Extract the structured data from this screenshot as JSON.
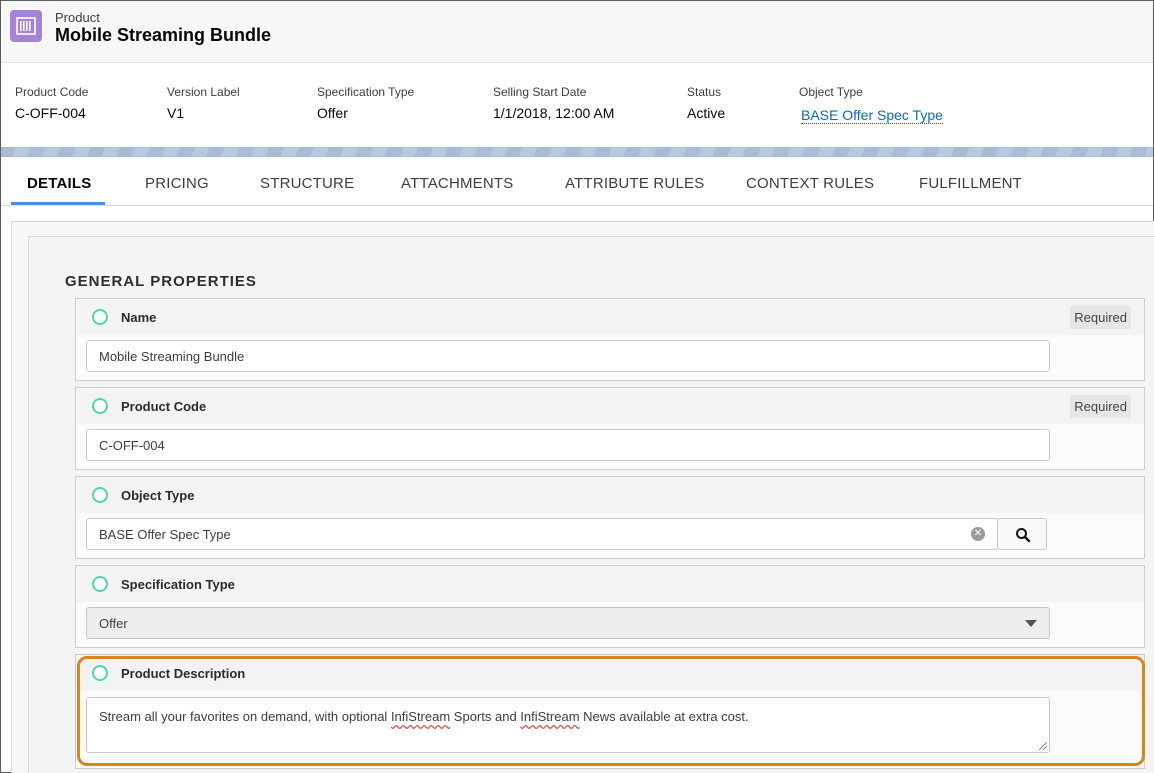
{
  "header": {
    "kicker": "Product",
    "title": "Mobile Streaming Bundle",
    "icon": "product-icon",
    "icon_color": "#a583d6"
  },
  "highlights": [
    {
      "label": "Product Code",
      "value": "C-OFF-004"
    },
    {
      "label": "Version Label",
      "value": "V1"
    },
    {
      "label": "Specification Type",
      "value": "Offer"
    },
    {
      "label": "Selling Start Date",
      "value": "1/1/2018, 12:00 AM"
    },
    {
      "label": "Status",
      "value": "Active"
    },
    {
      "label": "Object Type",
      "value": "BASE Offer Spec Type"
    }
  ],
  "tabs": [
    {
      "label": "DETAILS",
      "active": true
    },
    {
      "label": "PRICING"
    },
    {
      "label": "STRUCTURE"
    },
    {
      "label": "ATTACHMENTS"
    },
    {
      "label": "ATTRIBUTE RULES"
    },
    {
      "label": "CONTEXT RULES"
    },
    {
      "label": "FULFILLMENT"
    }
  ],
  "section_title": "GENERAL PROPERTIES",
  "fields": {
    "name": {
      "label": "Name",
      "badge": "Required",
      "value": "Mobile Streaming Bundle"
    },
    "product_code": {
      "label": "Product Code",
      "badge": "Required",
      "value": "C-OFF-004"
    },
    "object_type": {
      "label": "Object Type",
      "value": "BASE Offer Spec Type"
    },
    "spec_type": {
      "label": "Specification Type",
      "value": "Offer"
    },
    "description": {
      "label": "Product Description",
      "text_parts": [
        "Stream all your favorites on demand, with optional ",
        "InfiStream",
        " Sports and ",
        "InfiStream",
        " News available at extra cost."
      ]
    }
  },
  "colors": {
    "accent": "#4a90d9",
    "link": "#0b68b8",
    "circle": "#4bd7b0",
    "highlight": "#d7861b"
  }
}
